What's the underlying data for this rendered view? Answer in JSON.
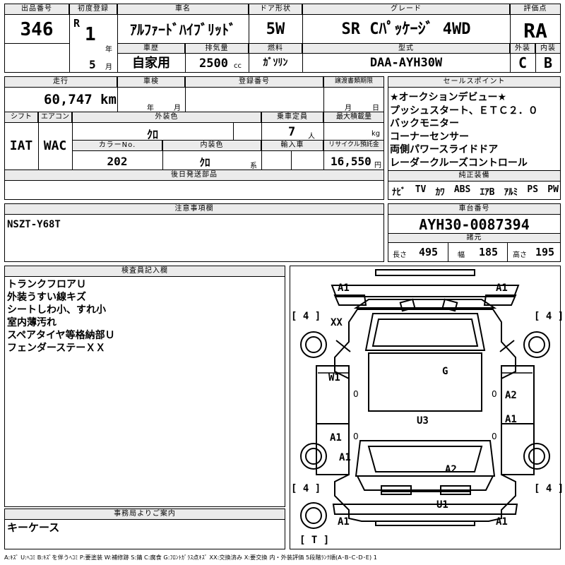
{
  "header": {
    "lot_label": "出品番号",
    "lot_value": "346",
    "reg_label": "初度登録",
    "reg_era": "R",
    "reg_year": "1",
    "reg_year_unit": "年",
    "reg_month": "5",
    "reg_month_unit": "月",
    "name_label": "車名",
    "name_value": "ｱﾙﾌｧｰﾄﾞﾊｲﾌﾞﾘｯﾄﾞ",
    "door_label": "ドア形状",
    "door_value": "5W",
    "grade_label": "グレード",
    "grade_value": "SR Cﾊﾟｯｹｰｼﾞ 4WD",
    "score_label": "評価点",
    "score_value": "RA",
    "history_label": "車歴",
    "history_value": "自家用",
    "disp_label": "排気量",
    "disp_value": "2500",
    "disp_unit": "cc",
    "fuel_label": "燃料",
    "fuel_value": "ｶﾞｿﾘﾝ",
    "model_label": "型式",
    "model_value": "DAA-AYH30W",
    "ext_label": "外装",
    "ext_value": "C",
    "int_label": "内装",
    "int_value": "B"
  },
  "row2": {
    "mileage_label": "走行",
    "mileage_value": "60,747",
    "mileage_unit": "km",
    "inspect_label": "車検",
    "inspect_year": "年",
    "inspect_month": "月",
    "regno_label": "登録番号",
    "transfer_label": "譲渡書類期限",
    "transfer_month": "月",
    "transfer_day": "日",
    "shift_label": "シフト",
    "shift_value": "IAT",
    "ac_label": "エアコン",
    "ac_value": "WAC",
    "color_label": "外装色",
    "color_value": "ｸﾛ",
    "seats_label": "乗車定員",
    "seats_value": "7",
    "seats_unit": "人",
    "load_label": "最大積載量",
    "load_unit": "kg",
    "colorno_label": "カラーNo.",
    "colorno_value": "202",
    "intcolor_label": "内装色",
    "intcolor_value": "ｸﾛ",
    "intcolor_unit": "系",
    "import_label": "輸入車",
    "recycle_label": "リサイクル預託金",
    "recycle_value": "16,550",
    "recycle_unit": "円",
    "later_label": "後日発送部品"
  },
  "sales": {
    "label": "セールスポイント",
    "items": [
      "★オークションデビュー★",
      "プッシュスタート、ＥＴＣ２．０",
      "バックモニター",
      "コーナーセンサー",
      "両側パワースライドドア",
      "レーダークルーズコントロール"
    ]
  },
  "equip": {
    "label": "純正装備",
    "items": [
      "ﾅﾋﾞ",
      "TV",
      "ｶﾜ",
      "ABS",
      "ｴｱB",
      "ｱﾙﾐ",
      "PS",
      "PW"
    ]
  },
  "notes": {
    "label": "注意事項欄",
    "value": "NSZT-Y68T"
  },
  "chassis": {
    "label": "車台番号",
    "value": "AYH30-0087394",
    "dims_label": "諸元",
    "length_label": "長さ",
    "length_value": "495",
    "width_label": "幅",
    "width_value": "185",
    "height_label": "高さ",
    "height_value": "195"
  },
  "inspector": {
    "label": "検査員記入欄",
    "items": [
      "トランクフロアＵ",
      "外装うすい線キズ",
      "シートしわ小、すれ小",
      "室内薄汚れ",
      "スペアタイヤ等格納部Ｕ",
      "フェンダーステーＸＸ"
    ]
  },
  "diagram": {
    "marks": {
      "a1_front_left": "A1",
      "a1_front_right": "A1",
      "xx": "XX",
      "w1": "W1",
      "g": "G",
      "a2_right": "A2",
      "u3": "U3",
      "a1_right_mid": "A1",
      "a1_left_mid": "A1",
      "a1_left_low": "A1",
      "a2_rear": "A2",
      "u1": "U1",
      "a1_rear_left": "A1",
      "a1_rear_right": "A1"
    },
    "tires": {
      "fl": "4",
      "fr": "4",
      "rl": "4",
      "rr": "4",
      "spare": "T"
    },
    "zeros": {
      "left_front": "0",
      "right_front": "0",
      "left_rear": "0",
      "right_rear": "0"
    }
  },
  "office": {
    "label": "事務局よりご案内",
    "value": "キーケース"
  },
  "legend": "A:ｷｽﾞ U:ﾍｺﾐ B:ｷｽﾞを伴うﾍｺﾐ P:要塗装 W:補修跡 S:錆 C:腐食 G:ﾌﾛﾝﾄｶﾞﾗｽ点ｷｽﾞ XX:交換済み X:要交換 内・外装評価 5段階ﾗﾝｸ順(A･B･C･D･E) 1"
}
